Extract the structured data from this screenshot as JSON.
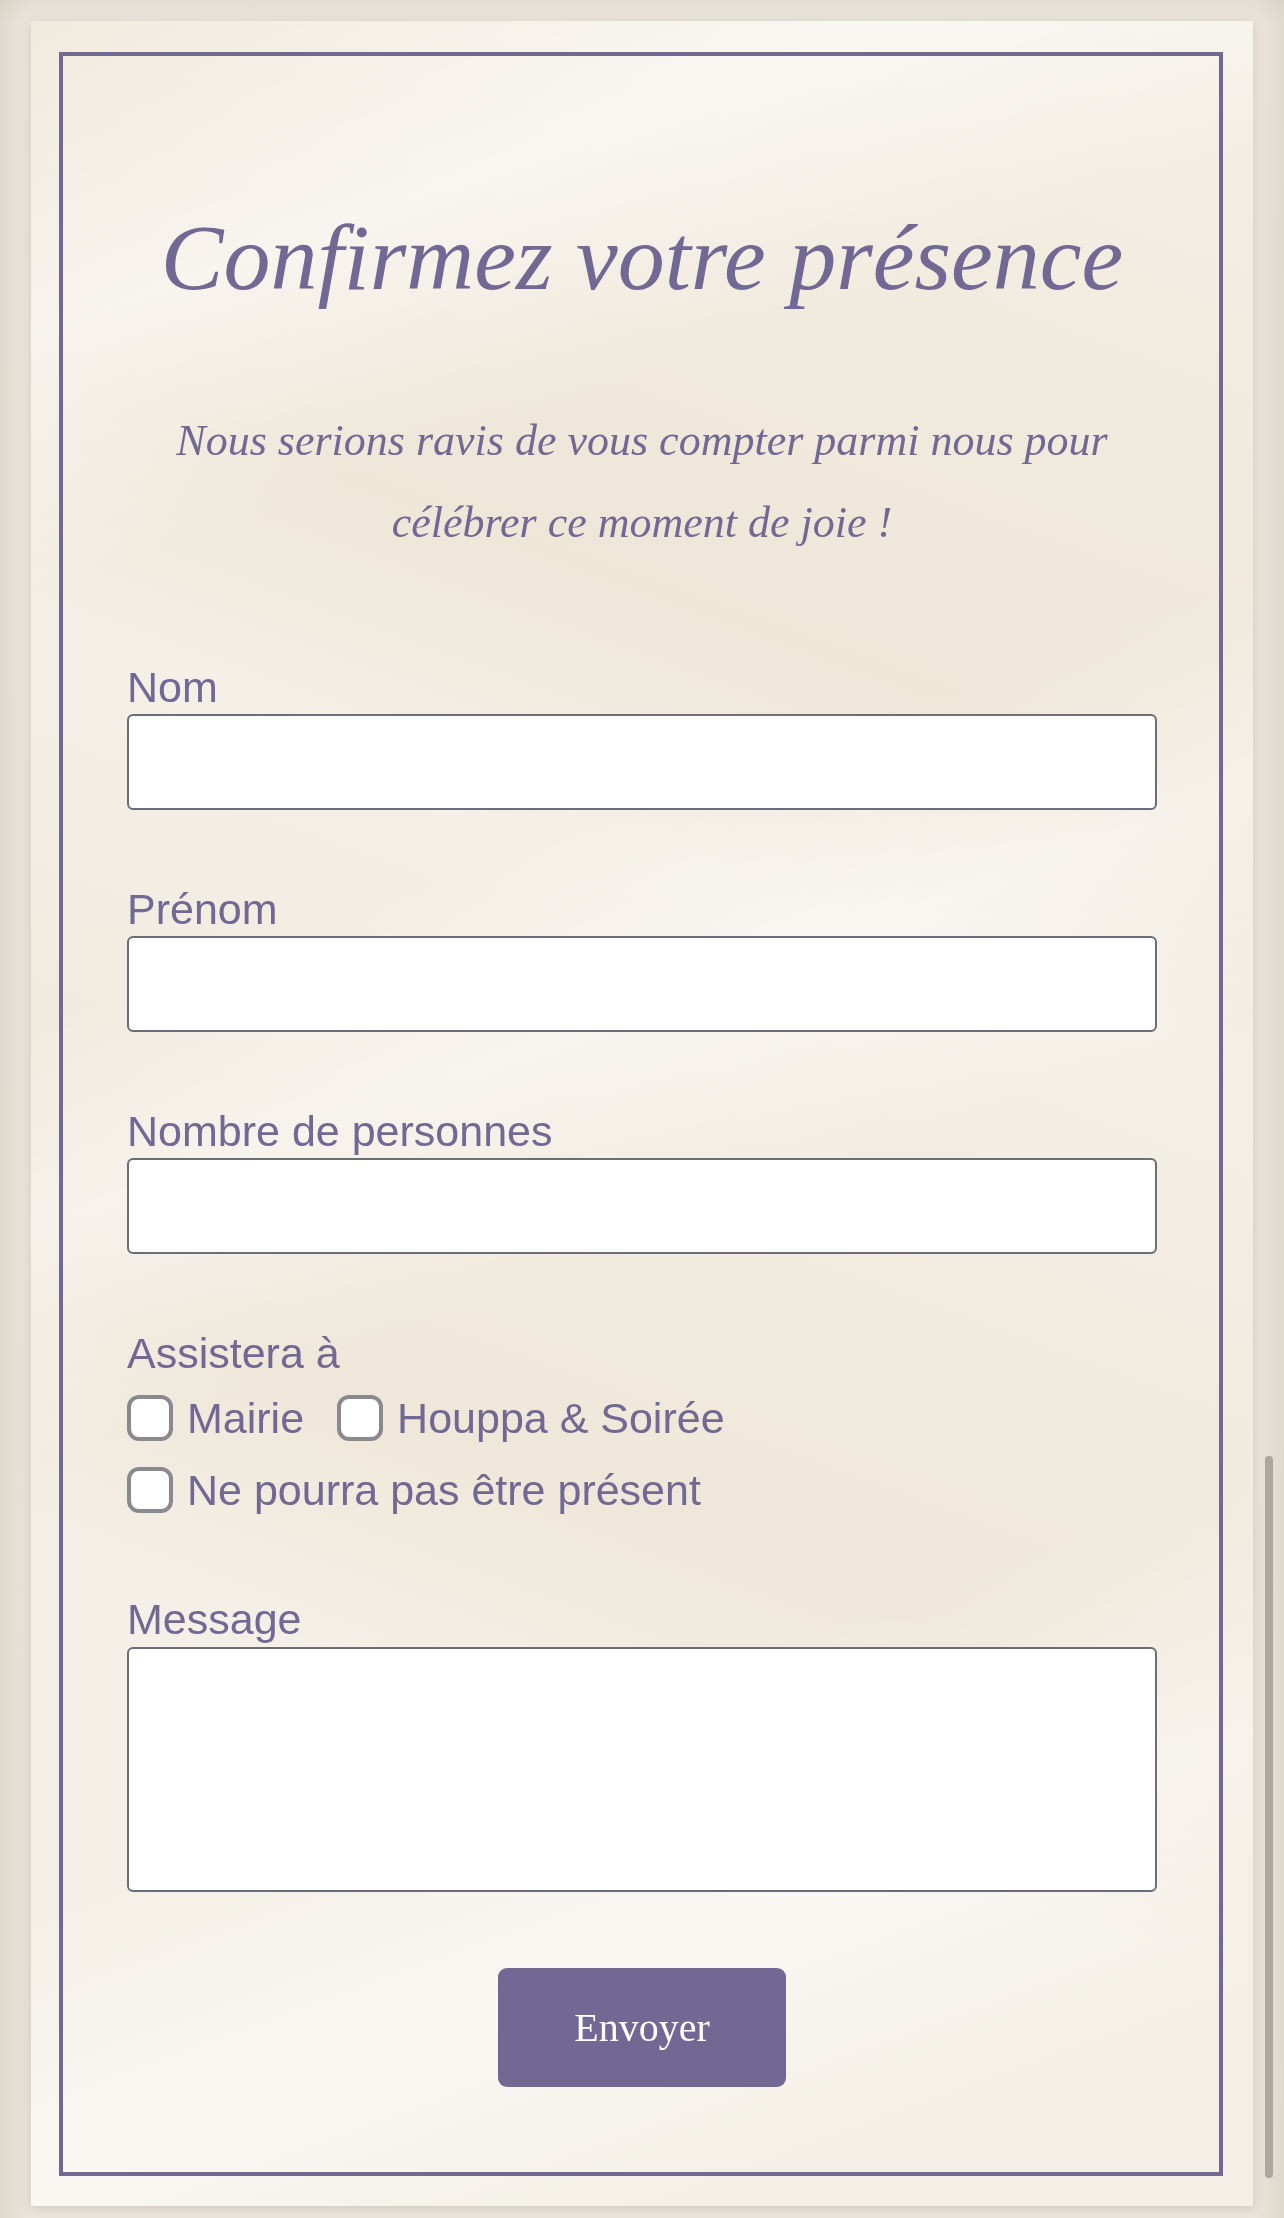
{
  "title": "Confirmez votre présence",
  "intro": "Nous serions ravis de vous compter parmi nous pour célébrer ce moment de joie !",
  "form": {
    "fields": [
      {
        "kind": "text",
        "label": "Nom"
      },
      {
        "kind": "text",
        "label": "Prénom"
      },
      {
        "kind": "text",
        "label": "Nombre de personnes"
      },
      {
        "kind": "checkboxes",
        "label": "Assistera à",
        "options": [
          {
            "label": "Mairie",
            "checked": false
          },
          {
            "label": "Houppa & Soirée",
            "checked": false
          },
          {
            "label": "Ne pourra pas être présent",
            "checked": false
          }
        ]
      },
      {
        "kind": "textarea",
        "label": "Message"
      }
    ],
    "submit_button": "Envoyer"
  }
}
